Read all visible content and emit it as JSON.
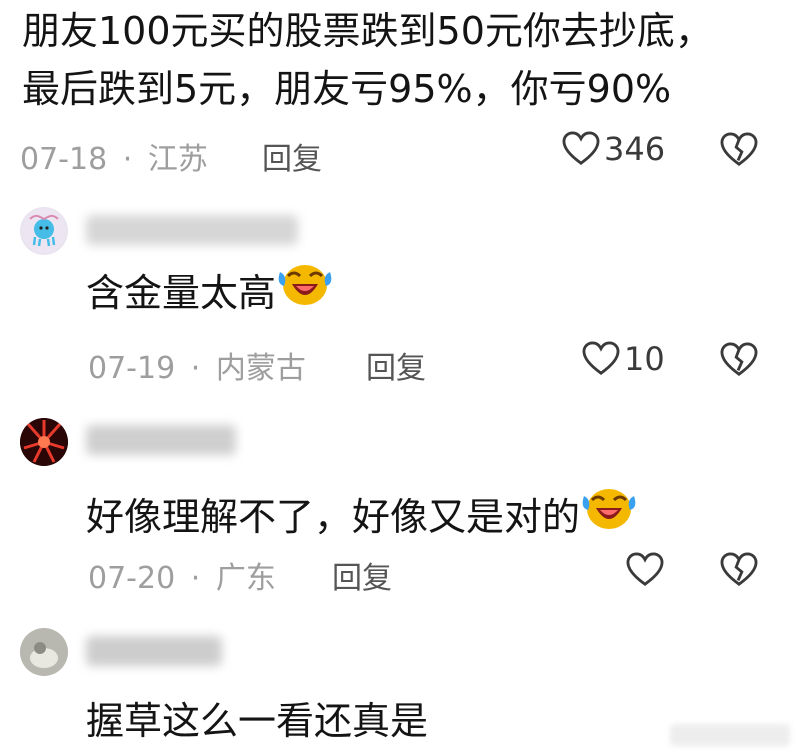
{
  "post": {
    "text_line1": "朋友100元买的股票跌到50元你去抄底，",
    "text_line2": "最后跌到5元，朋友亏95%，你亏90%",
    "date": "07-18",
    "location": "江苏",
    "reply_label": "回复",
    "likes": "346"
  },
  "comments": [
    {
      "text": "含金量太高",
      "date": "07-19",
      "location": "内蒙古",
      "reply_label": "回复",
      "likes": "10",
      "emoji": "laughing-crying-emoji"
    },
    {
      "text": "好像理解不了，好像又是对的",
      "date": "07-20",
      "location": "广东",
      "reply_label": "回复",
      "likes": "",
      "emoji": "laughing-crying-emoji"
    },
    {
      "text": "握草这么一看还真是",
      "date": "",
      "location": "",
      "reply_label": "",
      "likes": ""
    }
  ],
  "meta_separator": "·",
  "colors": {
    "text": "#141414",
    "meta": "#9e9e9e",
    "emoji_face": "#f5b800",
    "emoji_tear": "#3aa0f0"
  },
  "icons": [
    "heart-icon",
    "broken-heart-icon",
    "avatar",
    "laughing-crying-emoji"
  ]
}
